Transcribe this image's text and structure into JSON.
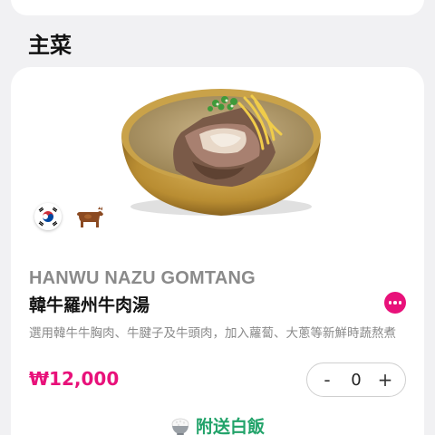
{
  "section": {
    "title": "主菜"
  },
  "menu_item": {
    "name_en": "HANWU NAZU GOMTANG",
    "name_zh": "韓牛羅州牛肉湯",
    "description": "選用韓牛牛胸肉、牛腱子及牛頭肉，加入蘿蔔、大蔥等新鮮時蔬熬煮",
    "price": "₩12,000",
    "quantity": "0",
    "minus_label": "-",
    "plus_label": "+",
    "origin_icon": "korea-flag-icon",
    "meat_icon": "cow-icon",
    "side_dish": "附送白飯",
    "side_dish_icon": "rice-bowl-icon"
  },
  "colors": {
    "accent": "#e8117a",
    "side_dish": "#22a36a",
    "background": "#f1f1f3"
  }
}
